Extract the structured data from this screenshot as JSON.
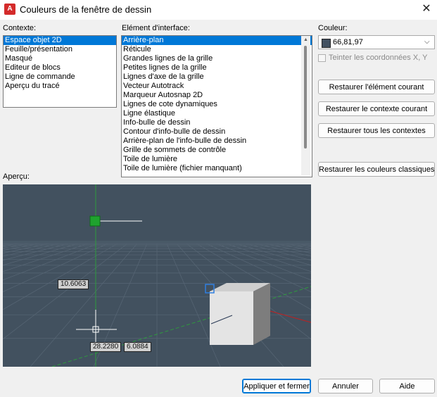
{
  "window": {
    "title": "Couleurs de la fenêtre de dessin",
    "icon": "autocad-logo-icon",
    "icon_letter": "A",
    "close_glyph": "✕"
  },
  "context": {
    "label": "Contexte:",
    "selected_index": 0,
    "items": [
      "Espace objet 2D",
      "Feuille/présentation",
      "Masqué",
      "Editeur de blocs",
      "Ligne de commande",
      "Aperçu du tracé"
    ]
  },
  "interface_element": {
    "label": "Elément d'interface:",
    "selected_index": 0,
    "items": [
      "Arrière-plan",
      "Réticule",
      "Grandes lignes de la grille",
      "Petites lignes de la grille",
      "Lignes d'axe de la grille",
      "Vecteur Autotrack",
      "Marqueur Autosnap 2D",
      "Lignes de cote dynamiques",
      "Ligne élastique",
      "Info-bulle de dessin",
      "Contour d'info-bulle de dessin",
      "Arrière-plan de l'info-bulle de dessin",
      "Grille de sommets de contrôle",
      "Toile de lumière",
      "Toile de lumière (fichier manquant)"
    ]
  },
  "color": {
    "label": "Couleur:",
    "value": "66,81,97",
    "swatch": "#425161",
    "chevron": "⌵"
  },
  "tint": {
    "label": "Teinter les coordonnées X, Y",
    "checked": false
  },
  "buttons": {
    "restore_element": "Restaurer l'élément courant",
    "restore_context": "Restaurer le contexte courant",
    "restore_all": "Restaurer tous les contextes",
    "restore_classic": "Restaurer les couleurs classiques",
    "apply_close": "Appliquer et fermer",
    "cancel": "Annuler",
    "help": "Aide"
  },
  "preview": {
    "label": "Aperçu:",
    "coords": {
      "dim_value": "10.6063",
      "x_value": "28.2280",
      "y_value": "6.0884"
    }
  },
  "colors": {
    "accent": "#0078d7",
    "preview_bg": "#42515f",
    "grid_axis": "#2e9a3e",
    "autosnap": "#1fa32e"
  }
}
